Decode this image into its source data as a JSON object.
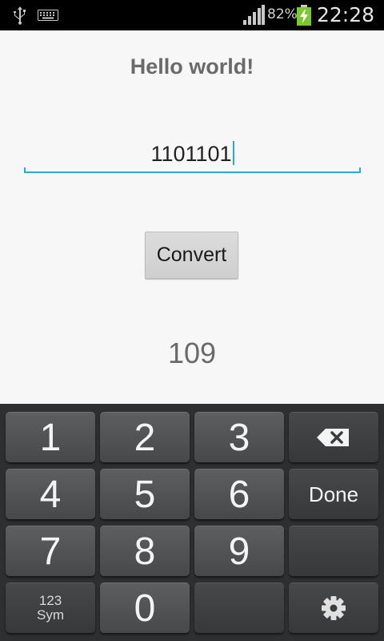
{
  "status_bar": {
    "battery_percent": "82%",
    "time": "22:28",
    "icons": [
      "usb-icon",
      "keyboard-icon",
      "signal-icon",
      "battery-charging-icon"
    ]
  },
  "main": {
    "title": "Hello world!",
    "input_value": "1101101",
    "convert_label": "Convert",
    "result": "109"
  },
  "keyboard": {
    "keys": [
      "1",
      "2",
      "3",
      "4",
      "5",
      "6",
      "7",
      "8",
      "9",
      "0"
    ],
    "done_label": "Done",
    "sym_label_top": "123",
    "sym_label_bottom": "Sym",
    "icons": [
      "backspace-icon",
      "gear-icon"
    ]
  },
  "colors": {
    "accent": "#2ba8e0",
    "battery": "#7cc92e"
  }
}
